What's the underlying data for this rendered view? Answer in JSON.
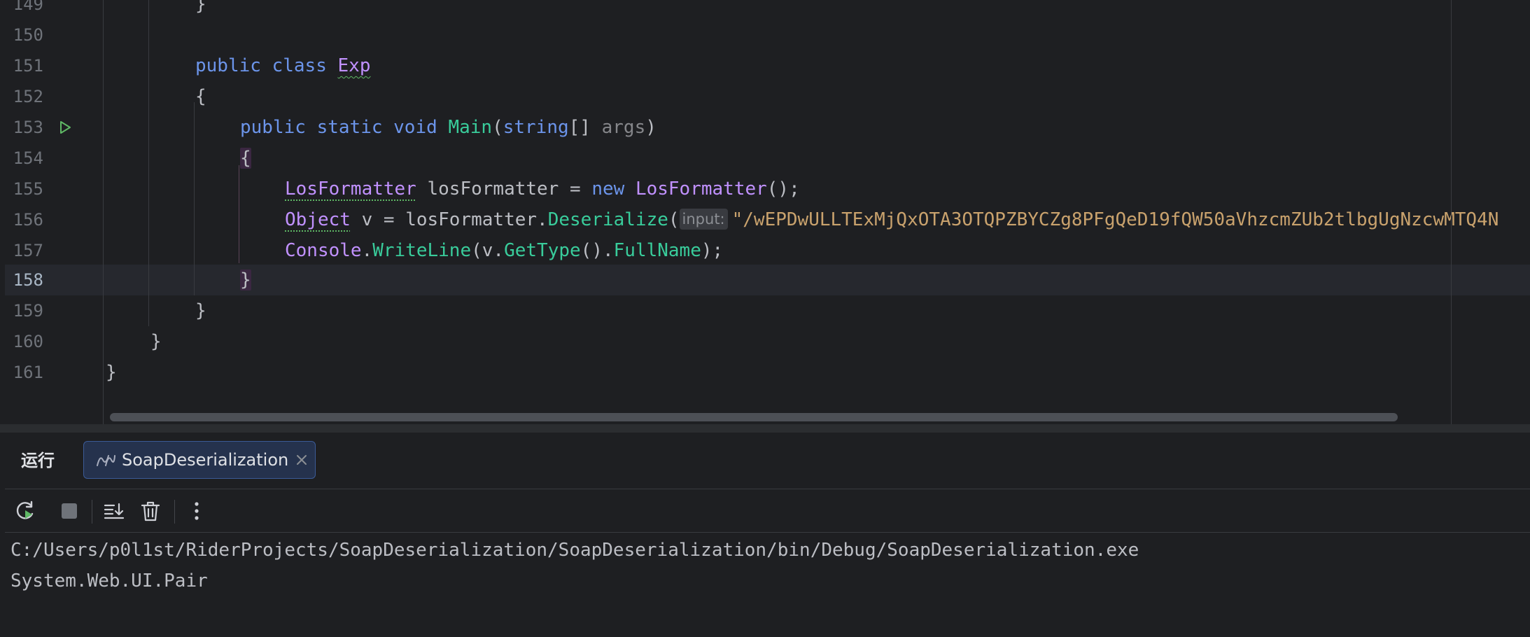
{
  "editor": {
    "line_numbers": [
      "149",
      "150",
      "151",
      "152",
      "153",
      "154",
      "155",
      "156",
      "157",
      "158",
      "159",
      "160",
      "161"
    ],
    "lines": {
      "l149": {
        "brace": "}"
      },
      "l151": {
        "kw_public": "public",
        "kw_class": "class",
        "class_name": "Exp"
      },
      "l152": {
        "brace": "{"
      },
      "l153": {
        "kw_public": "public",
        "kw_static": "static",
        "kw_void": "void",
        "method": "Main",
        "open": "(",
        "type": "string",
        "arr": "[]",
        "param": "args",
        "close": ")"
      },
      "l154": {
        "brace": "{"
      },
      "l155": {
        "type": "LosFormatter",
        "var": "losFormatter",
        "eq": "=",
        "kw_new": "new",
        "ctor": "LosFormatter",
        "end": "();"
      },
      "l156": {
        "type": "Object",
        "var_decl": "v = losFormatter.",
        "method": "Deserialize",
        "open": "(",
        "hint": "input:",
        "string": "\"/wEPDwULLTExMjQxOTA3OTQPZBYCZg8PFgQeD19fQW50aVhzcmZUb2tlbgUgNzcwMTQ4N"
      },
      "l157": {
        "cls": "Console",
        "dot": ".",
        "method": "WriteLine",
        "open": "(v.",
        "method2": "GetType",
        "mid": "().",
        "prop": "FullName",
        "end": ");"
      },
      "l158": {
        "brace": "}"
      },
      "l159": {
        "brace": "}"
      },
      "l160": {
        "brace": "}"
      },
      "l161": {
        "brace": "}"
      }
    },
    "current_line": "158"
  },
  "run_panel": {
    "title": "运行",
    "tab_label": "SoapDeserialization",
    "toolbar": [
      "rerun-icon",
      "stop-icon",
      "scroll-to-end-icon",
      "clear-all-icon",
      "more-icon"
    ],
    "output": [
      "C:/Users/p0l1st/RiderProjects/SoapDeserialization/SoapDeserialization/bin/Debug/SoapDeserialization.exe",
      "System.Web.UI.Pair"
    ]
  },
  "colors": {
    "background": "#1e1f22",
    "keyword": "#6c95eb",
    "class": "#c191ff",
    "method": "#39cc9b",
    "string": "#c9a26d",
    "tab_active_bg": "#25324d"
  }
}
